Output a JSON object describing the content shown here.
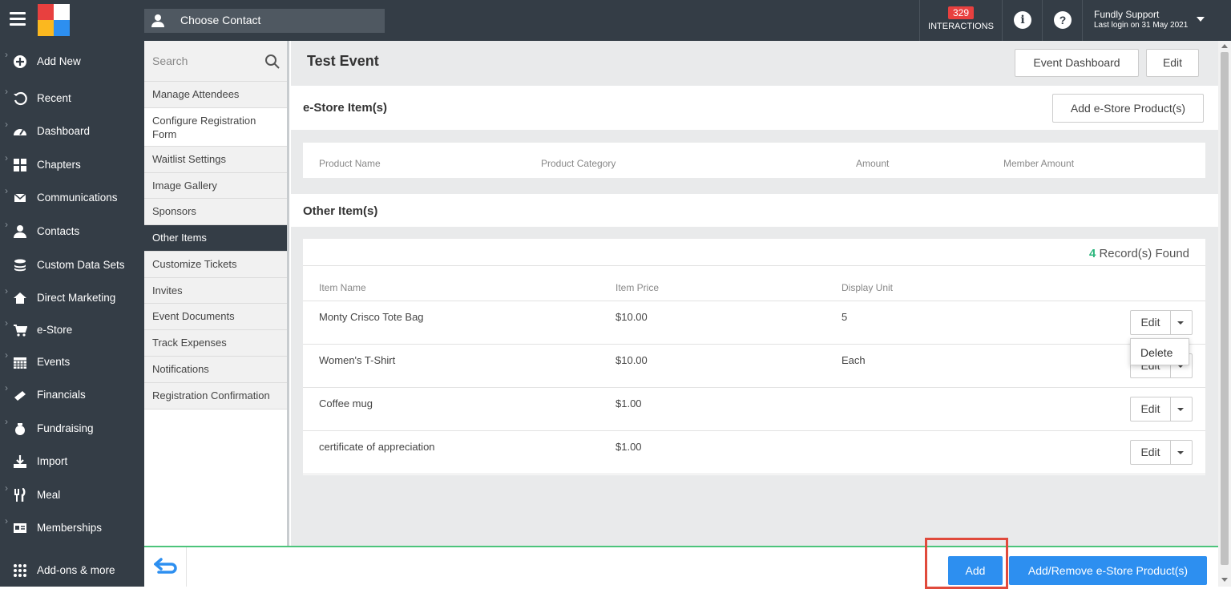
{
  "topbar": {
    "contact_label": "Choose Contact",
    "interactions_count": "329",
    "interactions_label": "INTERACTIONS",
    "user_name": "Fundly Support",
    "last_login": "Last login on 31 May 2021"
  },
  "sidebar": {
    "items": [
      {
        "label": "Add New",
        "chev": "›",
        "icon": "plus-circle-icon"
      },
      {
        "label": "Recent",
        "chev": "›",
        "icon": "history-icon"
      },
      {
        "label": "Dashboard",
        "chev": "›",
        "icon": "dashboard-icon"
      },
      {
        "label": "Chapters",
        "chev": "›",
        "icon": "grid-icon"
      },
      {
        "label": "Communications",
        "chev": "›",
        "icon": "envelope-icon"
      },
      {
        "label": "Contacts",
        "chev": "›",
        "icon": "user-icon"
      },
      {
        "label": "Custom Data Sets",
        "chev": "",
        "icon": "database-icon"
      },
      {
        "label": "Direct Marketing",
        "chev": "›",
        "icon": "home-icon"
      },
      {
        "label": "e-Store",
        "chev": "›",
        "icon": "cart-icon"
      },
      {
        "label": "Events",
        "chev": "›",
        "icon": "calendar-icon"
      },
      {
        "label": "Financials",
        "chev": "›",
        "icon": "money-icon"
      },
      {
        "label": "Fundraising",
        "chev": "›",
        "icon": "money-bag-icon"
      },
      {
        "label": "Import",
        "chev": "",
        "icon": "import-icon"
      },
      {
        "label": "Meal",
        "chev": "›",
        "icon": "utensils-icon"
      },
      {
        "label": "Memberships",
        "chev": "›",
        "icon": "id-card-icon"
      },
      {
        "label": "Add-ons & more",
        "chev": "",
        "icon": "apps-icon"
      }
    ]
  },
  "subnav": {
    "search_placeholder": "Search",
    "items": [
      "Manage Attendees",
      "Configure Registration Form",
      "Waitlist Settings",
      "Image Gallery",
      "Sponsors",
      "Other Items",
      "Customize Tickets",
      "Invites",
      "Event Documents",
      "Track Expenses",
      "Notifications",
      "Registration Confirmation"
    ],
    "active": "Other Items"
  },
  "main": {
    "title": "Test Event",
    "event_dashboard_label": "Event Dashboard",
    "edit_label": "Edit",
    "estore": {
      "title": "e-Store Item(s)",
      "add_button": "Add e-Store Product(s)",
      "columns": [
        "Product Name",
        "Product Category",
        "Amount",
        "Member Amount"
      ]
    },
    "other": {
      "title": "Other Item(s)",
      "record_count": "4",
      "record_label": "Record(s) Found",
      "columns": [
        "Item Name",
        "Item Price",
        "Display Unit"
      ],
      "rows": [
        {
          "name": "Monty Crisco Tote Bag",
          "price": "$10.00",
          "unit": "5"
        },
        {
          "name": "Women's T-Shirt",
          "price": "$10.00",
          "unit": "Each"
        },
        {
          "name": "Coffee mug",
          "price": "$1.00",
          "unit": ""
        },
        {
          "name": "certificate of appreciation",
          "price": "$1.00",
          "unit": ""
        }
      ],
      "row_edit_label": "Edit",
      "dropdown_delete": "Delete"
    }
  },
  "footer": {
    "add_label": "Add",
    "add_remove_label": "Add/Remove e-Store Product(s)"
  },
  "colors": {
    "dark": "#343d46",
    "accent_blue": "#2d8ff0",
    "green": "#4cc47b",
    "badge_red": "#e8403f"
  }
}
